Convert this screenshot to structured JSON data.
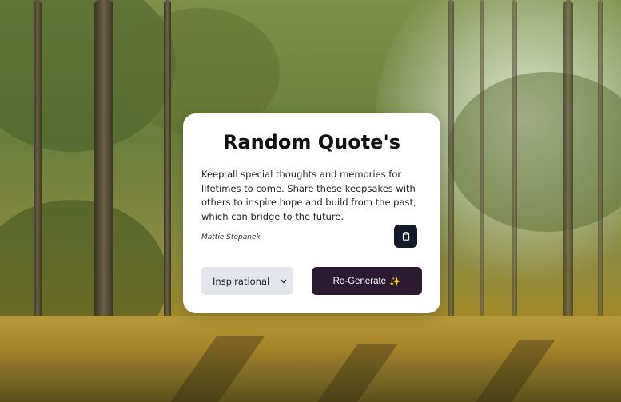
{
  "card": {
    "title": "Random Quote's",
    "quote": "Keep all special thoughts and memories for lifetimes to come. Share these keepsakes with others to inspire hope and build from the past, which can bridge to the future.",
    "author": "Mattie Stepanek"
  },
  "controls": {
    "category_selected": "Inspirational",
    "regenerate_label": "Re-Generate",
    "regenerate_emoji": "✨",
    "copy_icon": "clipboard-icon"
  },
  "colors": {
    "card_background": "#ffffff",
    "copy_button": "#141a2b",
    "regenerate_button": "#2c1a33",
    "select_background": "#e3e6ea"
  },
  "background": {
    "image": "forest-photo"
  }
}
